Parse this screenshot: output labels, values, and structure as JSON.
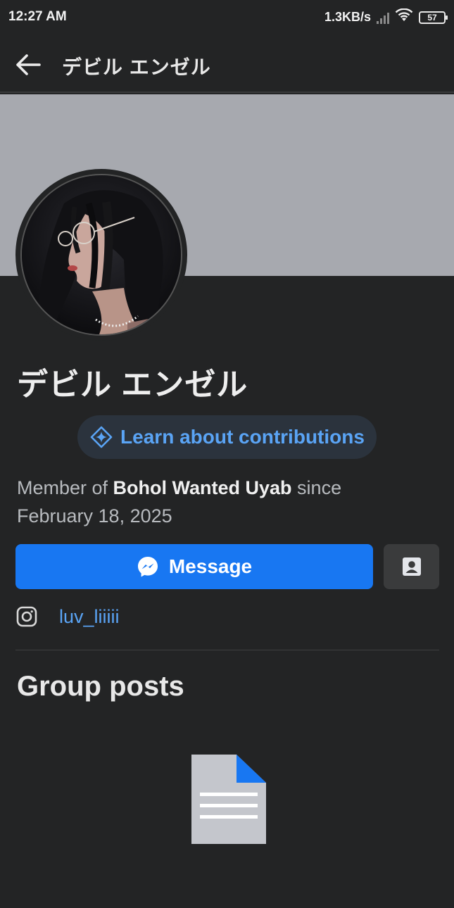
{
  "status_bar": {
    "time": "12:27 AM",
    "net_speed": "1.3KB/s",
    "battery": "57"
  },
  "header": {
    "title": "デビル エンゼル",
    "back_icon": "arrow-left-icon"
  },
  "profile": {
    "name": "デビル エンゼル",
    "contributions_label": "Learn about contributions",
    "member_prefix": "Member of ",
    "group_name": "Bohol Wanted Uyab",
    "member_suffix": " since",
    "member_date": "February 18, 2025"
  },
  "actions": {
    "message_label": "Message",
    "message_icon": "messenger-icon",
    "contact_icon": "contact-card-icon"
  },
  "links": {
    "instagram_icon": "instagram-icon",
    "instagram_handle": "luv_liiiii"
  },
  "sections": {
    "group_posts_title": "Group posts",
    "empty_icon": "document-icon"
  },
  "colors": {
    "background": "#232425",
    "accent": "#1877f2",
    "link": "#5aa4f5",
    "cover": "#a7a9af"
  }
}
